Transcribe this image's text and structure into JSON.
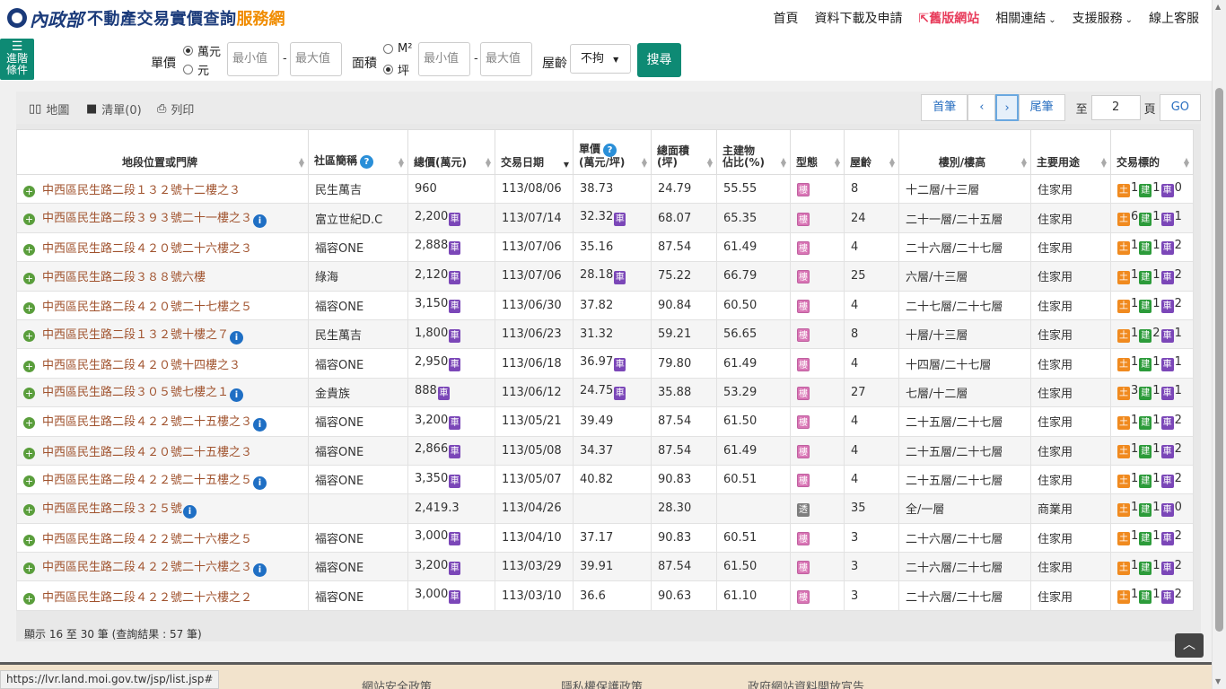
{
  "header": {
    "logo_calligraphy": "內政部",
    "logo_title": "不動產交易實價查詢",
    "logo_accent": "服務網",
    "nav": [
      {
        "label": "首頁",
        "kind": "plain"
      },
      {
        "label": "資料下載及申請",
        "kind": "plain"
      },
      {
        "label": "舊版網站",
        "kind": "legacy"
      },
      {
        "label": "相關連結",
        "kind": "dropdown"
      },
      {
        "label": "支援服務",
        "kind": "dropdown"
      },
      {
        "label": "線上客服",
        "kind": "plain"
      }
    ]
  },
  "search": {
    "advanced_label_1": "進階",
    "advanced_label_2": "條件",
    "unit_price_label": "單價",
    "unit_price_options": [
      "萬元",
      "元"
    ],
    "unit_price_selected": "萬元",
    "area_label": "面積",
    "area_options": [
      "M²",
      "坪"
    ],
    "area_selected": "坪",
    "min_placeholder": "最小值",
    "max_placeholder": "最大值",
    "dash": "-",
    "age_label": "屋齡",
    "age_value": "不拘",
    "search_button": "搜尋"
  },
  "toolbar": {
    "map": "地圖",
    "list": "清單(0)",
    "print": "列印"
  },
  "pager": {
    "first": "首筆",
    "prev": "‹",
    "next": "›",
    "last": "尾筆",
    "to_label": "至",
    "page_value": "2",
    "page_label": "頁",
    "go": "GO"
  },
  "table": {
    "headers": {
      "address": "地段位置或門牌",
      "community": "社區簡稱",
      "total_price": "總價(萬元)",
      "date": "交易日期",
      "unit_price_1": "單價",
      "unit_price_2": "(萬元/坪)",
      "area_1": "總面積",
      "area_2": "(坪)",
      "main_ratio_1": "主建物",
      "main_ratio_2": "佔比(%)",
      "type": "型態",
      "age": "屋齡",
      "floor": "樓別/樓高",
      "usage": "主要用途",
      "target": "交易標的"
    },
    "type_labels": {
      "building": "樓",
      "land": "透"
    },
    "target_labels": {
      "land": "土",
      "building": "建",
      "car": "車"
    },
    "rows": [
      {
        "address": "中西區民生路二段１３２號十二樓之３",
        "info": false,
        "community": "民生萬吉",
        "total": "960",
        "total_car": false,
        "date": "113/08/06",
        "unit": "38.73",
        "unit_car": false,
        "area": "24.79",
        "ratio": "55.55",
        "type": "building",
        "age": "8",
        "floor": "十二層/十三層",
        "usage": "住家用",
        "t_land": "1",
        "t_bldg": "1",
        "t_car": "0"
      },
      {
        "address": "中西區民生路二段３９３號二十一樓之３",
        "info": true,
        "community": "富立世紀D.C",
        "total": "2,200",
        "total_car": true,
        "date": "113/07/14",
        "unit": "32.32",
        "unit_car": true,
        "area": "68.07",
        "ratio": "65.35",
        "type": "building",
        "age": "24",
        "floor": "二十一層/二十五層",
        "usage": "住家用",
        "t_land": "6",
        "t_bldg": "1",
        "t_car": "1"
      },
      {
        "address": "中西區民生路二段４２０號二十六樓之３",
        "info": false,
        "community": "福容ONE",
        "total": "2,888",
        "total_car": true,
        "date": "113/07/06",
        "unit": "35.16",
        "unit_car": false,
        "area": "87.54",
        "ratio": "61.49",
        "type": "building",
        "age": "4",
        "floor": "二十六層/二十七層",
        "usage": "住家用",
        "t_land": "1",
        "t_bldg": "1",
        "t_car": "2"
      },
      {
        "address": "中西區民生路二段３８８號六樓",
        "info": false,
        "community": "綠海",
        "total": "2,120",
        "total_car": true,
        "date": "113/07/06",
        "unit": "28.18",
        "unit_car": true,
        "area": "75.22",
        "ratio": "66.79",
        "type": "building",
        "age": "25",
        "floor": "六層/十三層",
        "usage": "住家用",
        "t_land": "1",
        "t_bldg": "1",
        "t_car": "2"
      },
      {
        "address": "中西區民生路二段４２０號二十七樓之５",
        "info": false,
        "community": "福容ONE",
        "total": "3,150",
        "total_car": true,
        "date": "113/06/30",
        "unit": "37.82",
        "unit_car": false,
        "area": "90.84",
        "ratio": "60.50",
        "type": "building",
        "age": "4",
        "floor": "二十七層/二十七層",
        "usage": "住家用",
        "t_land": "1",
        "t_bldg": "1",
        "t_car": "2"
      },
      {
        "address": "中西區民生路二段１３２號十樓之７",
        "info": true,
        "community": "民生萬吉",
        "total": "1,800",
        "total_car": true,
        "date": "113/06/23",
        "unit": "31.32",
        "unit_car": false,
        "area": "59.21",
        "ratio": "56.65",
        "type": "building",
        "age": "8",
        "floor": "十層/十三層",
        "usage": "住家用",
        "t_land": "1",
        "t_bldg": "2",
        "t_car": "1"
      },
      {
        "address": "中西區民生路二段４２０號十四樓之３",
        "info": false,
        "community": "福容ONE",
        "total": "2,950",
        "total_car": true,
        "date": "113/06/18",
        "unit": "36.97",
        "unit_car": true,
        "area": "79.80",
        "ratio": "61.49",
        "type": "building",
        "age": "4",
        "floor": "十四層/二十七層",
        "usage": "住家用",
        "t_land": "1",
        "t_bldg": "1",
        "t_car": "1"
      },
      {
        "address": "中西區民生路二段３０５號七樓之１",
        "info": true,
        "community": "金貴族",
        "total": "888",
        "total_car": true,
        "date": "113/06/12",
        "unit": "24.75",
        "unit_car": true,
        "area": "35.88",
        "ratio": "53.29",
        "type": "building",
        "age": "27",
        "floor": "七層/十二層",
        "usage": "住家用",
        "t_land": "3",
        "t_bldg": "1",
        "t_car": "1"
      },
      {
        "address": "中西區民生路二段４２２號二十五樓之３",
        "info": true,
        "community": "福容ONE",
        "total": "3,200",
        "total_car": true,
        "date": "113/05/21",
        "unit": "39.49",
        "unit_car": false,
        "area": "87.54",
        "ratio": "61.50",
        "type": "building",
        "age": "4",
        "floor": "二十五層/二十七層",
        "usage": "住家用",
        "t_land": "1",
        "t_bldg": "1",
        "t_car": "2"
      },
      {
        "address": "中西區民生路二段４２０號二十五樓之３",
        "info": false,
        "community": "福容ONE",
        "total": "2,866",
        "total_car": true,
        "date": "113/05/08",
        "unit": "34.37",
        "unit_car": false,
        "area": "87.54",
        "ratio": "61.49",
        "type": "building",
        "age": "4",
        "floor": "二十五層/二十七層",
        "usage": "住家用",
        "t_land": "1",
        "t_bldg": "1",
        "t_car": "2"
      },
      {
        "address": "中西區民生路二段４２２號二十五樓之５",
        "info": true,
        "community": "福容ONE",
        "total": "3,350",
        "total_car": true,
        "date": "113/05/07",
        "unit": "40.82",
        "unit_car": false,
        "area": "90.83",
        "ratio": "60.51",
        "type": "building",
        "age": "4",
        "floor": "二十五層/二十七層",
        "usage": "住家用",
        "t_land": "1",
        "t_bldg": "1",
        "t_car": "2"
      },
      {
        "address": "中西區民生路二段３２５號",
        "info": true,
        "community": "",
        "total": "2,419.3",
        "total_car": false,
        "date": "113/04/26",
        "unit": "",
        "unit_car": false,
        "area": "28.30",
        "ratio": "",
        "type": "land",
        "age": "35",
        "floor": "全/一層",
        "usage": "商業用",
        "t_land": "1",
        "t_bldg": "1",
        "t_car": "0"
      },
      {
        "address": "中西區民生路二段４２２號二十六樓之５",
        "info": false,
        "community": "福容ONE",
        "total": "3,000",
        "total_car": true,
        "date": "113/04/10",
        "unit": "37.17",
        "unit_car": false,
        "area": "90.83",
        "ratio": "60.51",
        "type": "building",
        "age": "3",
        "floor": "二十六層/二十七層",
        "usage": "住家用",
        "t_land": "1",
        "t_bldg": "1",
        "t_car": "2"
      },
      {
        "address": "中西區民生路二段４２２號二十六樓之３",
        "info": true,
        "community": "福容ONE",
        "total": "3,200",
        "total_car": true,
        "date": "113/03/29",
        "unit": "39.91",
        "unit_car": false,
        "area": "87.54",
        "ratio": "61.50",
        "type": "building",
        "age": "3",
        "floor": "二十六層/二十七層",
        "usage": "住家用",
        "t_land": "1",
        "t_bldg": "1",
        "t_car": "2"
      },
      {
        "address": "中西區民生路二段４２２號二十六樓之２",
        "info": false,
        "community": "福容ONE",
        "total": "3,000",
        "total_car": true,
        "date": "113/03/10",
        "unit": "36.6",
        "unit_car": false,
        "area": "90.63",
        "ratio": "61.10",
        "type": "building",
        "age": "3",
        "floor": "二十六層/二十七層",
        "usage": "住家用",
        "t_land": "1",
        "t_bldg": "1",
        "t_car": "2"
      }
    ],
    "summary": "顯示 16 至 30 筆 (查詢結果 : 57 筆)"
  },
  "footer": {
    "links": [
      "網站安全政策",
      "隱私權保護政策",
      "政府網站資料開放宣告"
    ],
    "status_url": "https://lvr.land.moi.gov.tw/jsp/list.jsp#"
  },
  "colors": {
    "brand_green": "#0e8a74",
    "logo_blue": "#1a3a7a",
    "accent_orange": "#f08c00",
    "legacy_red": "#e83d5c",
    "address_brown": "#a0522d",
    "car_purple": "#7b47b8",
    "land_orange": "#f08a1f",
    "bldg_green": "#2c9b3a",
    "type_pink": "#d975b5"
  }
}
